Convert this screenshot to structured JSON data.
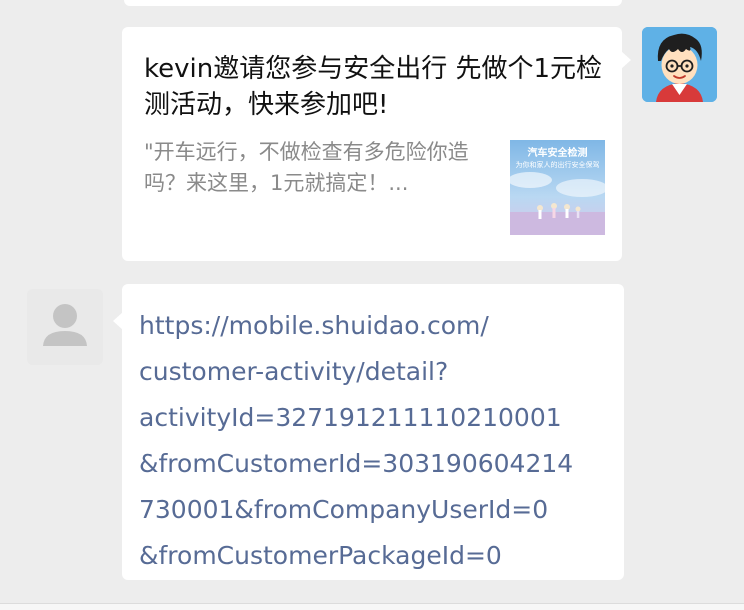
{
  "messages": [
    {
      "type": "link_card",
      "direction": "sent",
      "title": "kevin邀请您参与安全出行 先做个1元检测活动，快来参加吧!",
      "description": "\"开车远行，不做检查有多危险你造吗？来这里，1元就搞定！...",
      "thumbnail_caption": "汽车安全检测",
      "thumbnail_subcaption": "为你和家人的出行安全保驾"
    },
    {
      "type": "text",
      "direction": "received",
      "text": "https://mobile.shuidao.com/customer-activity/detail?activityId=327191211110210001&fromCustomerId=303190604214730001&fromCompanyUserId=0&fromCustomerPackageId=0",
      "lines": [
        "https://mobile.shuidao.com/",
        "customer-activity/detail?",
        "activityId=327191211110210001",
        "&fromCustomerId=303190604214",
        "730001&fromCompanyUserId=0",
        "&fromCustomerPackageId=0"
      ]
    }
  ],
  "colors": {
    "background": "#ededed",
    "bubble": "#ffffff",
    "link": "#576b95",
    "desc_text": "#8a8a8a"
  },
  "icons": {
    "self_avatar": "cartoon-boy-avatar",
    "other_avatar": "default-person-avatar"
  }
}
